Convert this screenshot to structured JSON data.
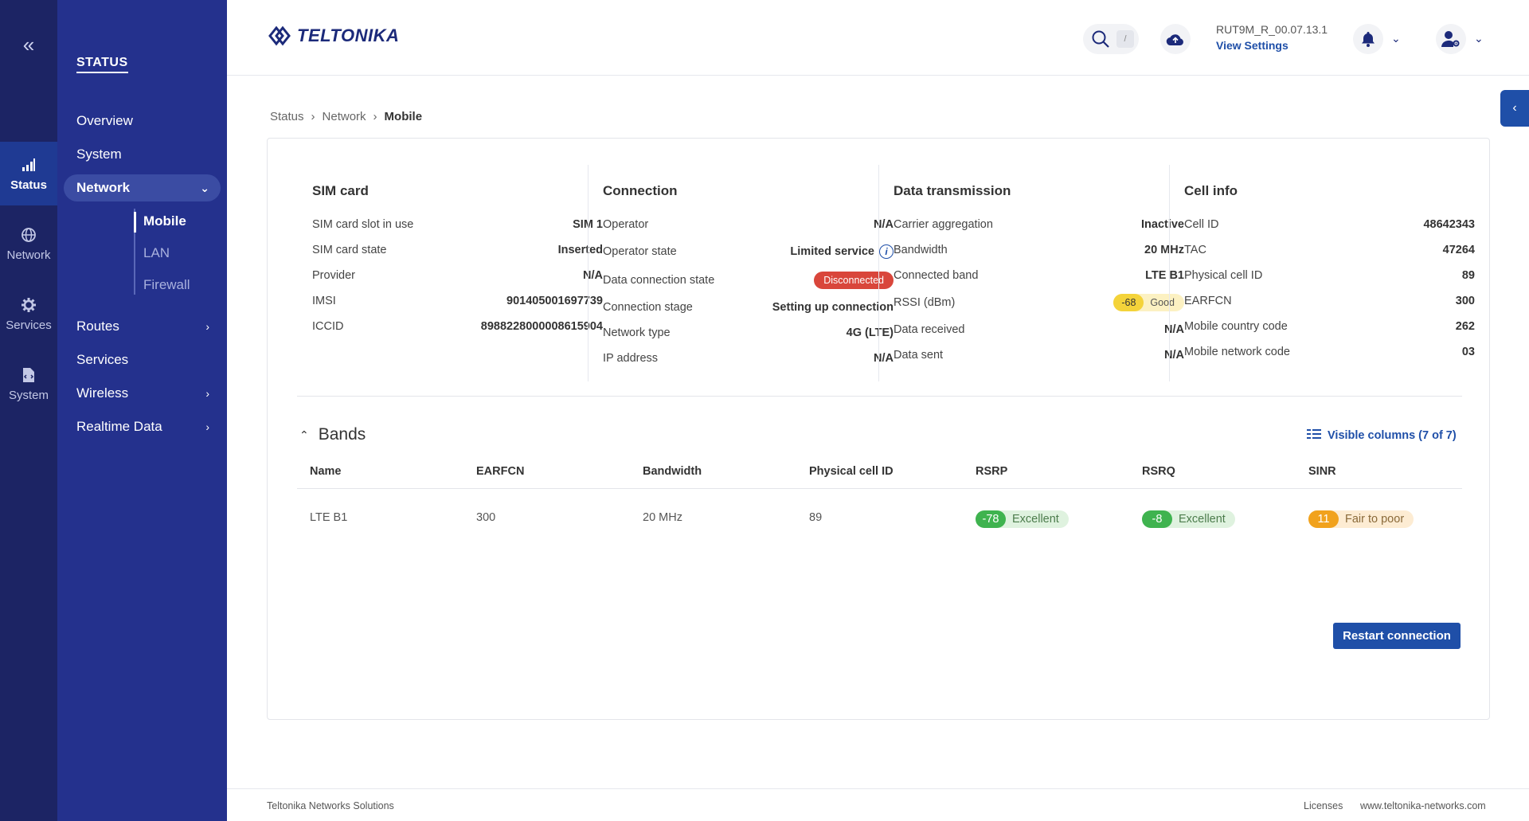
{
  "rail": {
    "items": [
      {
        "label": "Status"
      },
      {
        "label": "Network"
      },
      {
        "label": "Services"
      },
      {
        "label": "System"
      }
    ]
  },
  "sidebar": {
    "title": "STATUS",
    "items": [
      {
        "label": "Overview"
      },
      {
        "label": "System"
      },
      {
        "label": "Network"
      },
      {
        "label": "Routes"
      },
      {
        "label": "Services"
      },
      {
        "label": "Wireless"
      },
      {
        "label": "Realtime Data"
      }
    ],
    "network_sub": [
      {
        "label": "Mobile"
      },
      {
        "label": "LAN"
      },
      {
        "label": "Firewall"
      }
    ]
  },
  "header": {
    "brand": "TELTONIKA",
    "search_key": "/",
    "firmware": "RUT9M_R_00.07.13.1",
    "view_settings": "View Settings"
  },
  "breadcrumb": [
    "Status",
    "Network",
    "Mobile"
  ],
  "sim": {
    "title": "SIM card",
    "rows": [
      {
        "k": "SIM card slot in use",
        "v": "SIM 1"
      },
      {
        "k": "SIM card state",
        "v": "Inserted"
      },
      {
        "k": "Provider",
        "v": "N/A"
      },
      {
        "k": "IMSI",
        "v": "901405001697739"
      },
      {
        "k": "ICCID",
        "v": "8988228000008615904"
      }
    ]
  },
  "connection": {
    "title": "Connection",
    "rows": [
      {
        "k": "Operator",
        "v": "N/A"
      },
      {
        "k": "Operator state",
        "v": "Limited service"
      },
      {
        "k": "Data connection state",
        "v": "Disconnected"
      },
      {
        "k": "Connection stage",
        "v": "Setting up connection"
      },
      {
        "k": "Network type",
        "v": "4G (LTE)"
      },
      {
        "k": "IP address",
        "v": "N/A"
      }
    ]
  },
  "data_tx": {
    "title": "Data transmission",
    "rows": [
      {
        "k": "Carrier aggregation",
        "v": "Inactive"
      },
      {
        "k": "Bandwidth",
        "v": "20 MHz"
      },
      {
        "k": "Connected band",
        "v": "LTE B1"
      },
      {
        "k": "RSSI (dBm)",
        "v": "-68",
        "q": "Good"
      },
      {
        "k": "Data received",
        "v": "N/A"
      },
      {
        "k": "Data sent",
        "v": "N/A"
      }
    ]
  },
  "cell": {
    "title": "Cell info",
    "rows": [
      {
        "k": "Cell ID",
        "v": "48642343"
      },
      {
        "k": "TAC",
        "v": "47264"
      },
      {
        "k": "Physical cell ID",
        "v": "89"
      },
      {
        "k": "EARFCN",
        "v": "300"
      },
      {
        "k": "Mobile country code",
        "v": "262"
      },
      {
        "k": "Mobile network code",
        "v": "03"
      }
    ]
  },
  "bands": {
    "title": "Bands",
    "visible_columns": "Visible columns (7 of 7)",
    "columns": [
      "Name",
      "EARFCN",
      "Bandwidth",
      "Physical cell ID",
      "RSRP",
      "RSRQ",
      "SINR"
    ],
    "row": {
      "name": "LTE B1",
      "earfcn": "300",
      "bandwidth": "20 MHz",
      "pci": "89",
      "rsrp": "-78",
      "rsrp_q": "Excellent",
      "rsrq": "-8",
      "rsrq_q": "Excellent",
      "sinr": "11",
      "sinr_q": "Fair to poor"
    }
  },
  "restart_label": "Restart connection",
  "footer": {
    "company": "Teltonika Networks Solutions",
    "licenses": "Licenses",
    "site": "www.teltonika-networks.com"
  },
  "colors": {
    "rail": "#1c2464",
    "sidebar": "#24318d",
    "accent": "#1f4fa8",
    "danger": "#d9463b",
    "good": "#3fb34f",
    "warn": "#f1a21d",
    "fair": "#f4d33a"
  }
}
